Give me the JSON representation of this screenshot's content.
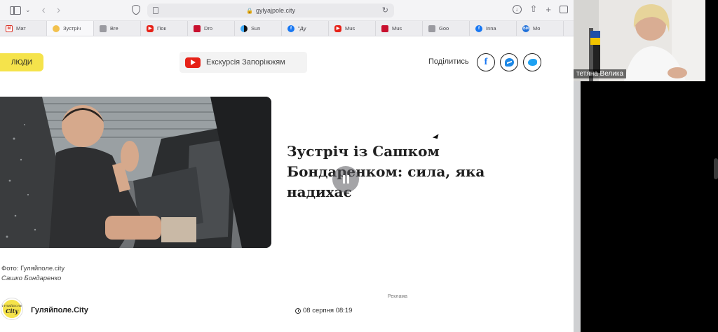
{
  "browser": {
    "url": "gylyajpole.city",
    "tabs": [
      {
        "label": "Мат",
        "favicon": "gmail-icon"
      },
      {
        "label": "Зустріч",
        "favicon": "site-icon",
        "active": true
      },
      {
        "label": "Bre",
        "favicon": "generic-icon"
      },
      {
        "label": "Пок",
        "favicon": "youtube-icon"
      },
      {
        "label": "Dro",
        "favicon": "red-icon"
      },
      {
        "label": "Sun",
        "favicon": "sun-icon"
      },
      {
        "label": "\"Ду",
        "favicon": "facebook-icon"
      },
      {
        "label": "Mus",
        "favicon": "youtube-icon"
      },
      {
        "label": "Mus",
        "favicon": "red-icon"
      },
      {
        "label": "Goo",
        "favicon": "generic-icon"
      },
      {
        "label": "Inna",
        "favicon": "facebook-icon"
      },
      {
        "label": "Mo",
        "favicon": "mo-icon"
      }
    ]
  },
  "page": {
    "people_button": "ЛЮДИ",
    "tour_button": "Екскурсія Запоріжжям",
    "share_label": "Поділитись",
    "headline": "Зустріч із Сашком Бондаренком: сила, яка надихає",
    "photo_credit": "Фото: Гуляйполе.city",
    "photo_subject": "Сашко Бондаренко",
    "ad_label": "Реклама",
    "site_name": "Гуляйполе.City",
    "logo_line1": "ГУЛЯЙПОЛЕ",
    "logo_line2": "City",
    "date": "08 серпня 08:19"
  },
  "video_call": {
    "participant_name": "тетяна Велика"
  },
  "colors": {
    "accent_yellow": "#f5e34b",
    "youtube_red": "#e62117",
    "facebook_blue": "#1877f2"
  }
}
